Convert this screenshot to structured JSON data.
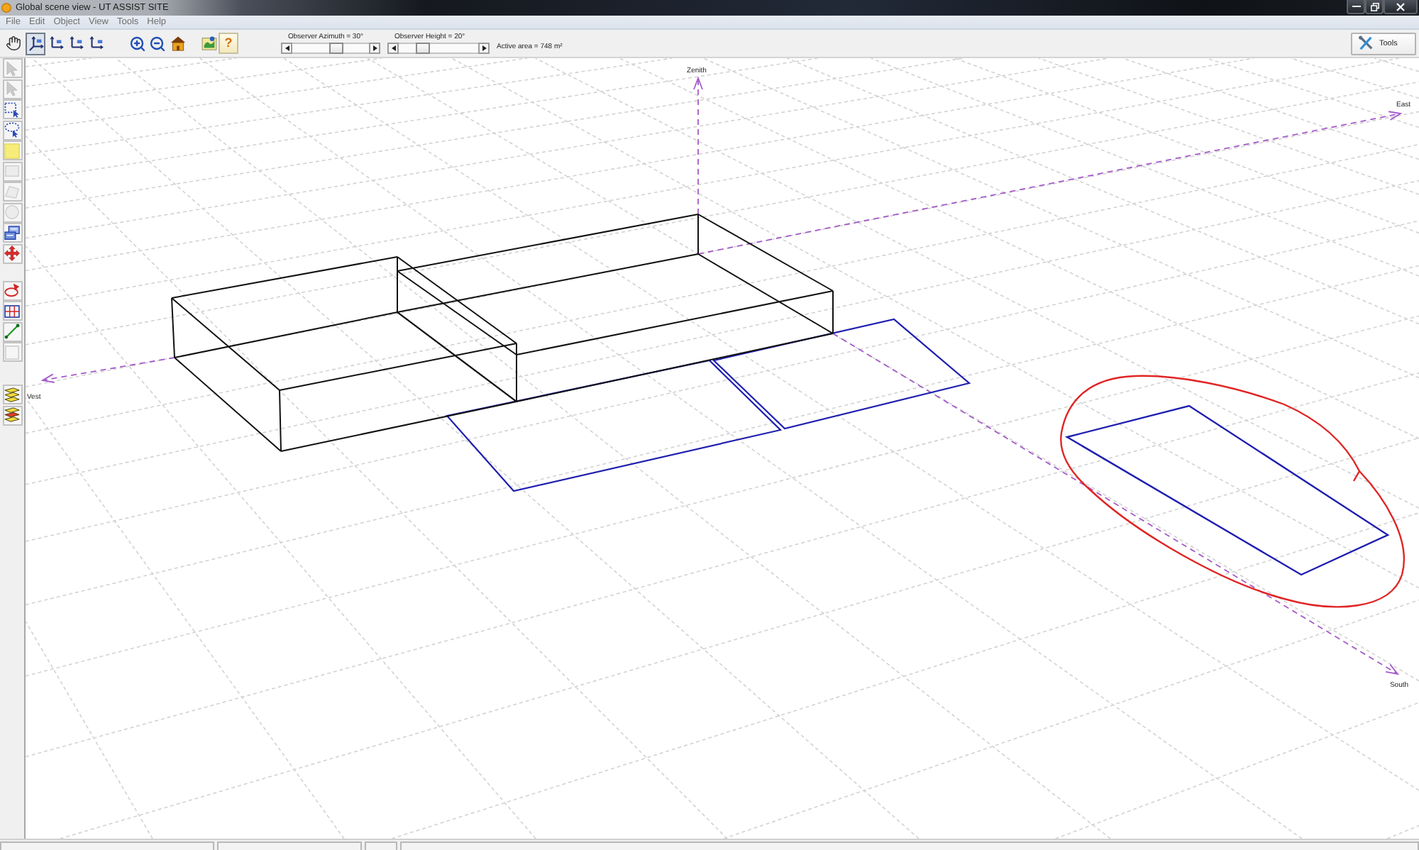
{
  "window": {
    "title": "Global scene view - UT ASSIST SITE"
  },
  "menu": [
    "File",
    "Edit",
    "Object",
    "View",
    "Tools",
    "Help"
  ],
  "toolbar": {
    "view_buttons": [
      {
        "selected": false
      },
      {
        "selected": true
      },
      {
        "selected": false
      },
      {
        "selected": false
      },
      {
        "selected": false
      }
    ],
    "help_button": "?",
    "sliders": [
      {
        "label": "Observer Azimuth = 30°",
        "level": 0.6
      },
      {
        "label": "Observer Height = 20°",
        "level": 0.25
      }
    ],
    "active_area": "Active area = 748 m²",
    "tools_button": "Tools"
  },
  "left_toolbar": [
    [
      {
        "disabled": true
      },
      {
        "disabled": true
      },
      {
        "disabled": false
      },
      {
        "disabled": false
      },
      {
        "disabled": false
      },
      {
        "disabled": true
      },
      {
        "disabled": true
      },
      {
        "disabled": true
      },
      {
        "disabled": false
      },
      {
        "disabled": false
      }
    ],
    [
      {
        "disabled": false
      },
      {
        "disabled": false
      },
      {
        "disabled": false
      },
      {
        "disabled": true
      }
    ],
    [
      {
        "disabled": false
      },
      {
        "disabled": false
      }
    ]
  ],
  "scene": {
    "axis_labels": [
      "Zenith",
      "East",
      "Vest",
      "South"
    ]
  }
}
